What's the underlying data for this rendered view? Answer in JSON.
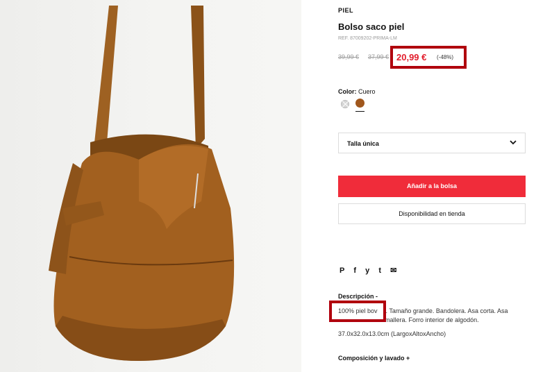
{
  "product": {
    "brand": "PIEL",
    "title": "Bolso saco piel",
    "ref": "REF. 87009202-PRIMA-LM",
    "old_price_1": "39,99 €",
    "old_price_2": "37,99 €",
    "price": "20,99 €",
    "discount": "(-48%)"
  },
  "color": {
    "label": "Color:",
    "value": "Cuero",
    "swatches": [
      "#d6d6d6",
      "#a0571d"
    ],
    "selected_index": 1
  },
  "size": {
    "label": "Talla única"
  },
  "buttons": {
    "add_to_bag": "Añadir a la bolsa",
    "availability": "Disponibilidad en tienda"
  },
  "share": {
    "icons": [
      "pinterest-icon",
      "facebook-icon",
      "twitter-icon",
      "tumblr-icon",
      "email-icon"
    ],
    "glyphs": [
      "P",
      "f",
      "y",
      "t",
      "✉"
    ]
  },
  "description": {
    "heading": "Descripción -",
    "line1": "100% piel bovino. Tamaño grande. Bandolera. Asa corta. Asa",
    "line2": "con cierre de cremallera. Forro interior de algodón.",
    "highlight": "100% piel bov",
    "dimensions": "37.0x32.0x13.0cm (LargoxAltoxAncho)"
  },
  "composition": {
    "heading": "Composición y lavado +"
  },
  "colors": {
    "accent": "#f02c3a",
    "sale": "#e21d2c",
    "annotation": "#b0000d"
  }
}
